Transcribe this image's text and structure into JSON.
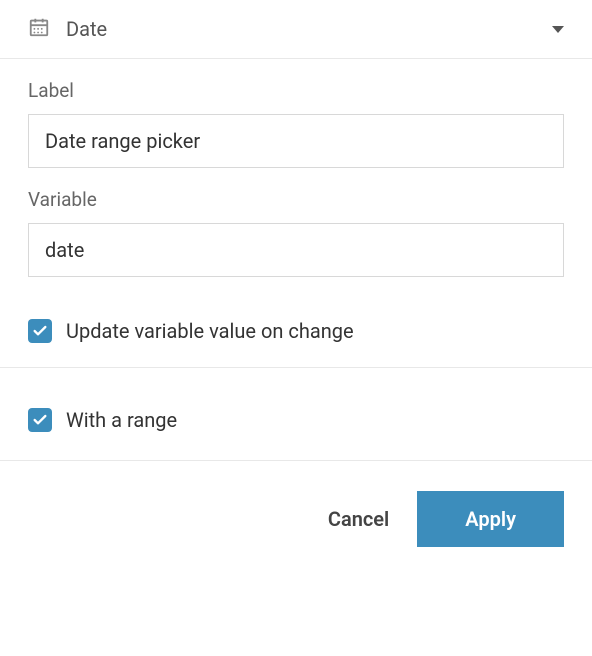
{
  "header": {
    "title": "Date"
  },
  "fields": {
    "label": {
      "caption": "Label",
      "value": "Date range picker"
    },
    "variable": {
      "caption": "Variable",
      "value": "date"
    }
  },
  "checkboxes": {
    "updateOnChange": {
      "label": "Update variable value on change",
      "checked": true
    },
    "withRange": {
      "label": "With a range",
      "checked": true
    }
  },
  "footer": {
    "cancel": "Cancel",
    "apply": "Apply"
  },
  "colors": {
    "accent": "#3c8dbc"
  }
}
